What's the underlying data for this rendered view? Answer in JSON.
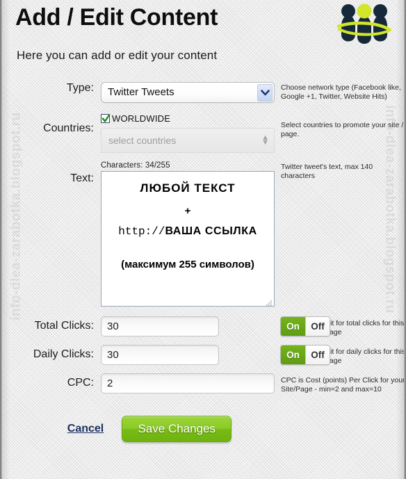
{
  "header": {
    "title": "Add / Edit Content",
    "subtitle": "Here you can add or edit your content",
    "logo_name": "people-group-orbit-logo"
  },
  "watermark": {
    "left": "info-dlea-zarabotka.blogspot.ru",
    "right": "info-dlea-zarabotka.blogspot.ru"
  },
  "form": {
    "type": {
      "label": "Type:",
      "selected": "Twitter Tweets",
      "options": [
        "Facebook like",
        "Google +1",
        "Twitter Tweets",
        "Website Hits"
      ],
      "hint": "Choose network type (Facebook like, Google +1, Twitter, Website Hits)"
    },
    "countries": {
      "label": "Countries:",
      "worldwide_label": "WORLDWIDE",
      "worldwide_checked": true,
      "placeholder": "select countries",
      "hint": "Select countries to promote your site / page."
    },
    "text": {
      "label": "Text:",
      "characters": "Characters: 34/255",
      "line1": "ЛЮБОЙ  ТЕКСТ",
      "line2": "+",
      "line3_url": "http://",
      "line3_bold": "ВАША  ССЫЛКА",
      "line4": "(максимум 255 символов)",
      "hint": "Twitter tweet's text, max 140 characters"
    },
    "total_clicks": {
      "label": "Total Clicks:",
      "value": "30",
      "toggle_on": "On",
      "toggle_off": "Off",
      "toggle_state": "On",
      "hint": "Set limit for total clicks for this site / page"
    },
    "daily_clicks": {
      "label": "Daily Clicks:",
      "value": "30",
      "toggle_on": "On",
      "toggle_off": "Off",
      "toggle_state": "On",
      "hint": "Set limit for daily clicks for this site / page"
    },
    "cpc": {
      "label": "CPC:",
      "value": "2",
      "hint": "CPC is Cost (points) Per Click for your Site/Page - min=2 and max=10"
    }
  },
  "actions": {
    "cancel": "Cancel",
    "save": "Save Changes"
  },
  "colors": {
    "accent_green": "#8bca26",
    "toggle_green": "#5f9c12",
    "logo_dark": "#16293a",
    "logo_lime": "#d2e62a",
    "link_navy": "#1c3060"
  }
}
